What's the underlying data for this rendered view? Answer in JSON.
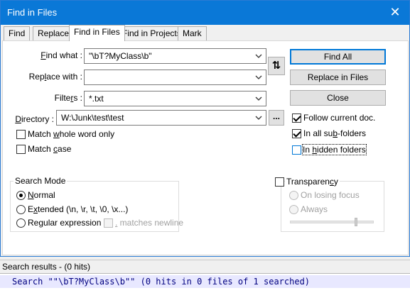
{
  "window": {
    "title": "Find in Files",
    "close_glyph": "✕"
  },
  "tabs": [
    {
      "label": "Find"
    },
    {
      "label": "Replace"
    },
    {
      "label": "Find in Files"
    },
    {
      "label": "Find in Projects"
    },
    {
      "label": "Mark"
    }
  ],
  "fields": {
    "find_what": {
      "label_pre": "",
      "label_ul": "F",
      "label_post": "ind what :",
      "value": "\"\\bT?MyClass\\b\""
    },
    "replace_with": {
      "label_pre": "Rep",
      "label_ul": "l",
      "label_post": "ace with :",
      "value": ""
    },
    "filters": {
      "label_pre": "Filte",
      "label_ul": "r",
      "label_post": "s :",
      "value": "*.txt"
    },
    "directory": {
      "label_pre": "",
      "label_ul": "D",
      "label_post": "irectory :",
      "value": "W:\\Junk\\test\\test"
    }
  },
  "swap_glyph": "⇅",
  "browse_label": "...",
  "buttons": {
    "find_all": "Find All",
    "replace_in_files": "Replace in Files",
    "close": "Close"
  },
  "options": {
    "match_whole_word": {
      "pre": "Match ",
      "ul": "w",
      "post": "hole word only",
      "checked": false
    },
    "match_case": {
      "pre": "Match ",
      "ul": "c",
      "post": "ase",
      "checked": false
    },
    "follow_current_doc": {
      "pre": "Follow current doc.",
      "ul": "",
      "post": "",
      "checked": true
    },
    "in_all_subfolders": {
      "pre": "In all su",
      "ul": "b",
      "post": "-folders",
      "checked": true
    },
    "in_hidden_folders": {
      "pre": "In ",
      "ul": "h",
      "post": "idden folders",
      "checked": false
    }
  },
  "search_mode": {
    "title": "Search Mode",
    "normal": {
      "pre": "",
      "ul": "N",
      "post": "ormal",
      "checked": true
    },
    "extended": {
      "pre": "E",
      "ul": "x",
      "post": "tended (\\n, \\r, \\t, \\0, \\x...)",
      "checked": false
    },
    "regex": {
      "pre": "Re",
      "ul": "g",
      "post": "ular expression",
      "checked": false
    },
    "matches_newline": {
      "pre": "",
      "ul": ".",
      "post": " matches newline",
      "checked": false
    }
  },
  "transparency": {
    "title_pre": "Transparen",
    "title_ul": "c",
    "title_post": "y",
    "checked": false,
    "on_losing_focus": "On losing focus",
    "always": "Always",
    "slider_level": 0.8
  },
  "results": {
    "title": "Search results - (0 hits)",
    "line": "Search \"\"\\bT?MyClass\\b\"\" (0 hits in 0 files of 1 searched)"
  },
  "colors": {
    "titlebar": "#0a78d7",
    "results_text": "#000080",
    "results_highlight": "#e8e8ff"
  }
}
